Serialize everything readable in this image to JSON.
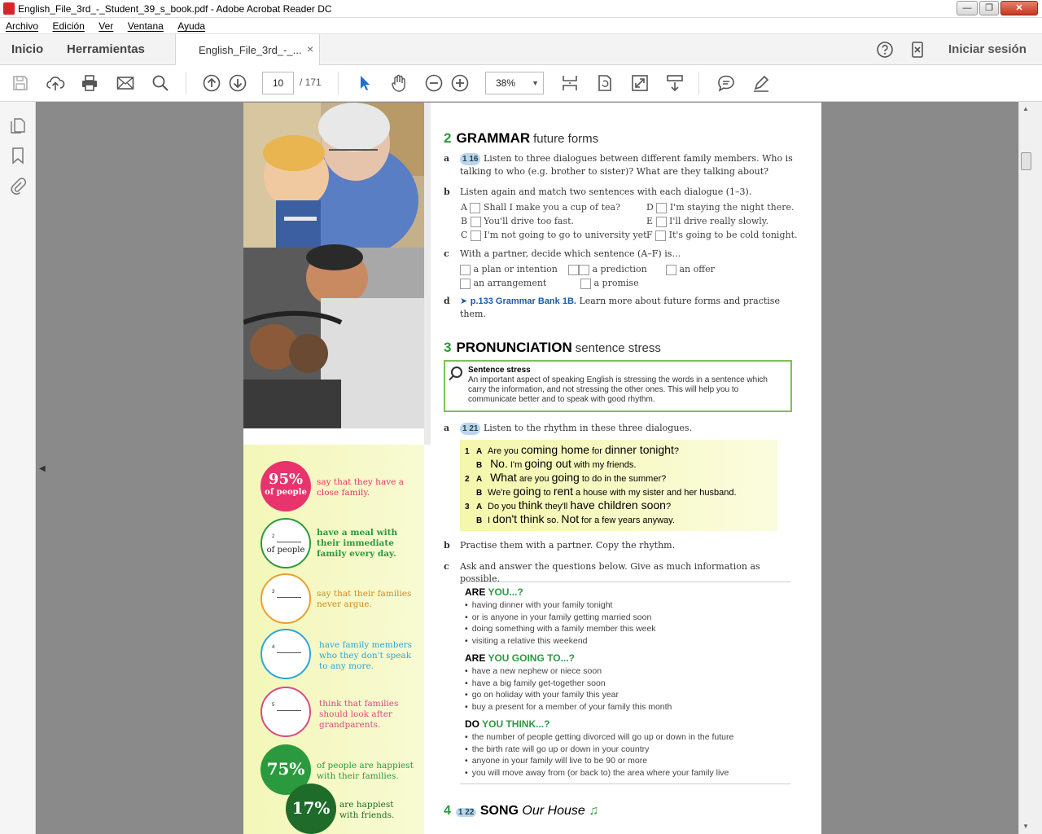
{
  "window": {
    "title": "English_File_3rd_-_Student_39_s_book.pdf - Adobe Acrobat Reader DC",
    "minimize": "—",
    "maximize": "❐",
    "close": "✕"
  },
  "menu": [
    "Archivo",
    "Edición",
    "Ver",
    "Ventana",
    "Ayuda"
  ],
  "tabs": {
    "home": "Inicio",
    "tools": "Herramientas",
    "document": "English_File_3rd_-_...",
    "document_close": "×",
    "signin": "Iniciar sesión"
  },
  "toolbar": {
    "page_current": "10",
    "page_total": "/ 171",
    "zoom": "38%",
    "zoom_caret": "▼"
  },
  "pane_toggle": {
    "left": "◀",
    "right": "▶"
  },
  "scroll_arrows": {
    "up": "▲",
    "down": "▼"
  },
  "stats": [
    {
      "big": "95%",
      "small": "of people",
      "text": "say that they have a close family.",
      "color": "#e8336d",
      "filled": true
    },
    {
      "num": "2",
      "op": "of people",
      "text": "have a meal with their immediate family every day.",
      "color": "#2b9a3e",
      "filled": false
    },
    {
      "num": "3",
      "text": "say that their families never argue.",
      "color": "#e8a030",
      "filled": false
    },
    {
      "num": "4",
      "text": "have family members who they don't speak to any more.",
      "color": "#2aa6d8",
      "filled": false
    },
    {
      "num": "5",
      "text": "think that families should look after grandparents.",
      "color": "#d94a86",
      "filled": false
    },
    {
      "big": "75%",
      "text": "of people are happiest with their families.",
      "color": "#2b9a3e",
      "filled": true
    },
    {
      "big": "17%",
      "text": "are happiest with friends.",
      "color": "#1e6b2a",
      "filled": true
    }
  ],
  "grammar": {
    "num": "2",
    "title": "GRAMMAR",
    "subtitle": "future forms",
    "a_badge": "1 16",
    "a_text": "Listen to three dialogues between different family members. Who is talking to who (e.g. brother to sister)? What are they talking about?",
    "b_text": "Listen again and match two sentences with each dialogue (1–3).",
    "b_options": [
      {
        "letter": "A",
        "text": "Shall I make you a cup of tea?"
      },
      {
        "letter": "B",
        "text": "You'll drive too fast."
      },
      {
        "letter": "C",
        "text": "I'm not going to go to university yet."
      },
      {
        "letter": "D",
        "text": "I'm staying the night there."
      },
      {
        "letter": "E",
        "text": "I'll drive really slowly."
      },
      {
        "letter": "F",
        "text": "It's going to be cold tonight."
      }
    ],
    "c_text": "With a partner, decide which sentence (A–F) is…",
    "c_options": [
      "a plan or intention",
      "an arrangement",
      "a prediction",
      "a promise",
      "an offer"
    ],
    "d_link": "p.133 Grammar Bank 1B.",
    "d_text": "Learn more about future forms and practise them."
  },
  "pronunciation": {
    "num": "3",
    "title": "PRONUNCIATION",
    "subtitle": "sentence stress",
    "box_head": "Sentence stress",
    "box_text": "An important aspect of speaking English is stressing the words in a sentence which carry the information, and not stressing the other ones. This will help you to communicate better and to speak with good rhythm.",
    "a_badge": "1 21",
    "a_text": "Listen to the rhythm in these three dialogues.",
    "dialogues": [
      {
        "n": "1",
        "who": "A",
        "pre": "Are you",
        "s1": "coming home",
        "mid": "for",
        "s2": "dinner tonight",
        "end": "?"
      },
      {
        "n": "",
        "who": "B",
        "pre": "",
        "s1": "No.",
        "mid": "I'm",
        "s2": "going out",
        "end": " with my friends."
      },
      {
        "n": "2",
        "who": "A",
        "pre": "",
        "s1": "What",
        "mid": "are you",
        "s2": "going",
        "end": " to do in the summer?"
      },
      {
        "n": "",
        "who": "B",
        "pre": "We're",
        "s1": "going",
        "mid": "to",
        "s2": "rent",
        "end": " a house with my sister and her husband."
      },
      {
        "n": "3",
        "who": "A",
        "pre": "Do you",
        "s1": "think",
        "mid": "they'll",
        "s2": "have children soon",
        "end": "?"
      },
      {
        "n": "",
        "who": "B",
        "pre": "I",
        "s1": "don't think",
        "mid": "so.",
        "s2": "Not",
        "end": " for a few years anyway."
      }
    ],
    "b_text": "Practise them with a partner. Copy the rhythm.",
    "c_text": "Ask and answer the questions below. Give as much information as possible.",
    "groups": [
      {
        "k": "ARE",
        "h": "YOU...?",
        "items": [
          "having dinner with your family tonight",
          "or is anyone in your family getting married soon",
          "doing something with a family member this week",
          "visiting a relative this weekend"
        ]
      },
      {
        "k": "ARE",
        "h": "YOU GOING TO...?",
        "items": [
          "have a new nephew or niece soon",
          "have a big family get-together soon",
          "go on holiday with your family this year",
          "buy a present for a member of your family this month"
        ]
      },
      {
        "k": "DO",
        "h": "YOU THINK...?",
        "items": [
          "the number of people getting divorced will go up or down in the future",
          "the birth rate will go up or down in your country",
          "anyone in your family will live to be 90 or more",
          "you will move away from (or back to) the area where your family live"
        ]
      }
    ]
  },
  "song": {
    "num": "4",
    "badge": "1 22",
    "title": "SONG",
    "name": "Our House",
    "note": "♫"
  },
  "colors": {
    "accent_green": "#2b9a3e",
    "link_blue": "#1d5aa6",
    "pdf_red": "#d7262b"
  }
}
